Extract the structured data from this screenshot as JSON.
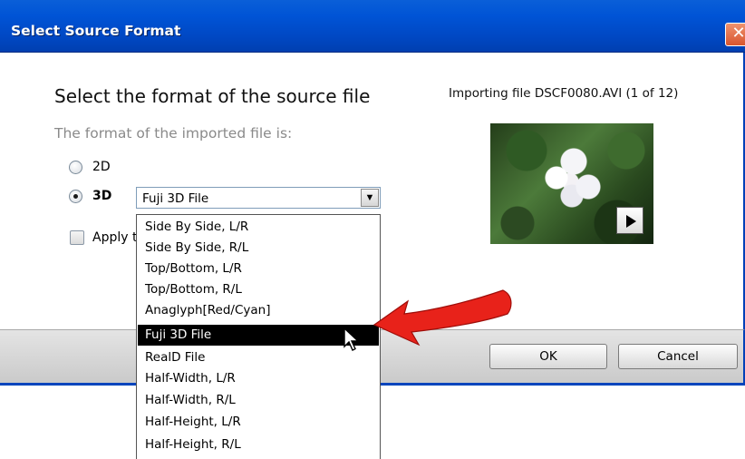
{
  "window": {
    "title": "Select Source Format",
    "close_glyph": "✕"
  },
  "main": {
    "heading": "Select the format of the source file",
    "subheading": "The format of the imported file is:",
    "option_2d": "2D",
    "option_3d": "3D",
    "selected_option": "3D",
    "format_select_value": "Fuji 3D File",
    "select_arrow_glyph": "▼",
    "apply_checkbox_label": "Apply t",
    "apply_checked": false
  },
  "preview": {
    "importing_text": "Importing file DSCF0080.AVI (1 of 12)"
  },
  "footer": {
    "ok_label": "OK",
    "cancel_label": "Cancel"
  },
  "dropdown": {
    "items": [
      "Side By Side, L/R",
      "Side By Side, R/L",
      "Top/Bottom, L/R",
      "Top/Bottom, R/L",
      "Anaglyph[Red/Cyan]",
      "Fuji 3D File",
      "RealD File",
      "Half-Width, L/R",
      "Half-Width, R/L",
      "Half-Height, L/R",
      "Half-Height, R/L"
    ],
    "selected": "Fuji 3D File"
  },
  "colors": {
    "titlebar": "#0054d6",
    "highlight": "#000000",
    "annotation_arrow": "#e8221a"
  },
  "icons": {
    "close": "close-icon",
    "play": "play-icon",
    "cursor": "mouse-cursor-icon",
    "annotation": "red-arrow-icon"
  }
}
